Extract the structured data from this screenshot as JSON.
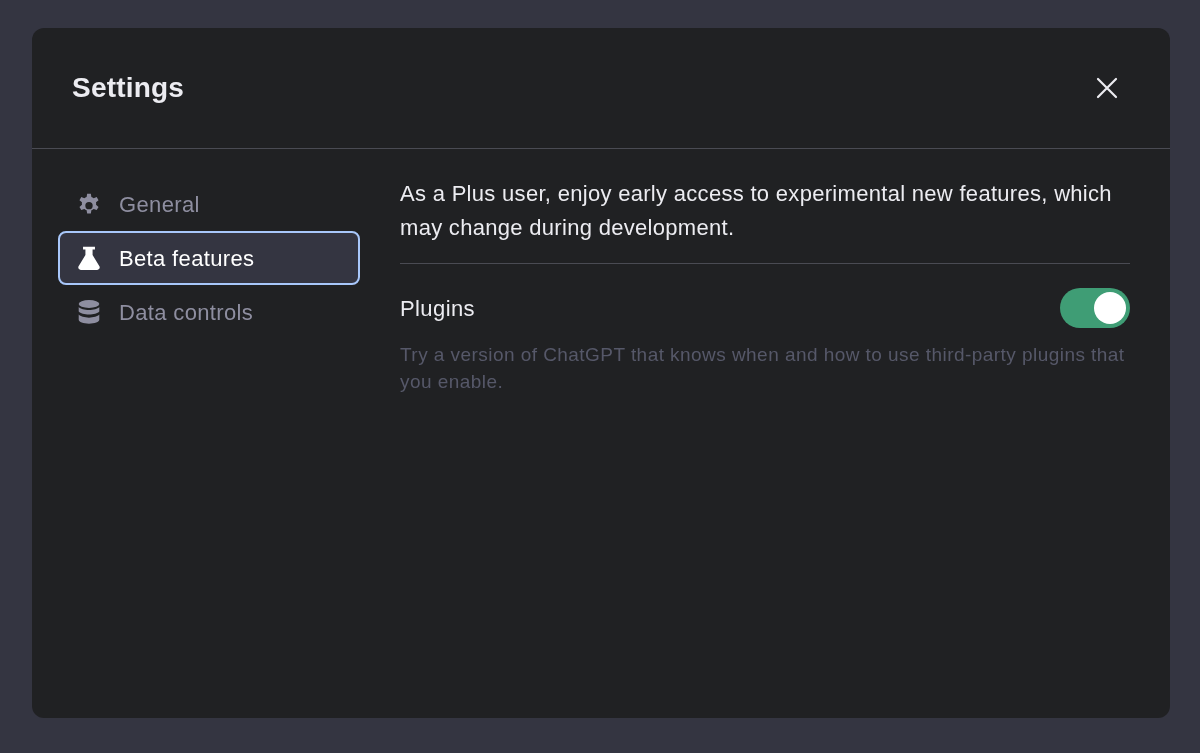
{
  "dialog": {
    "title": "Settings"
  },
  "sidebar": {
    "items": [
      {
        "label": "General",
        "selected": false
      },
      {
        "label": "Beta features",
        "selected": true
      },
      {
        "label": "Data controls",
        "selected": false
      }
    ]
  },
  "content": {
    "intro": "As a Plus user, enjoy early access to experimental new features, which may change during development.",
    "settings": [
      {
        "label": "Plugins",
        "on": true,
        "description": "Try a version of ChatGPT that knows when and how to use third-party plugins that you enable."
      }
    ]
  }
}
